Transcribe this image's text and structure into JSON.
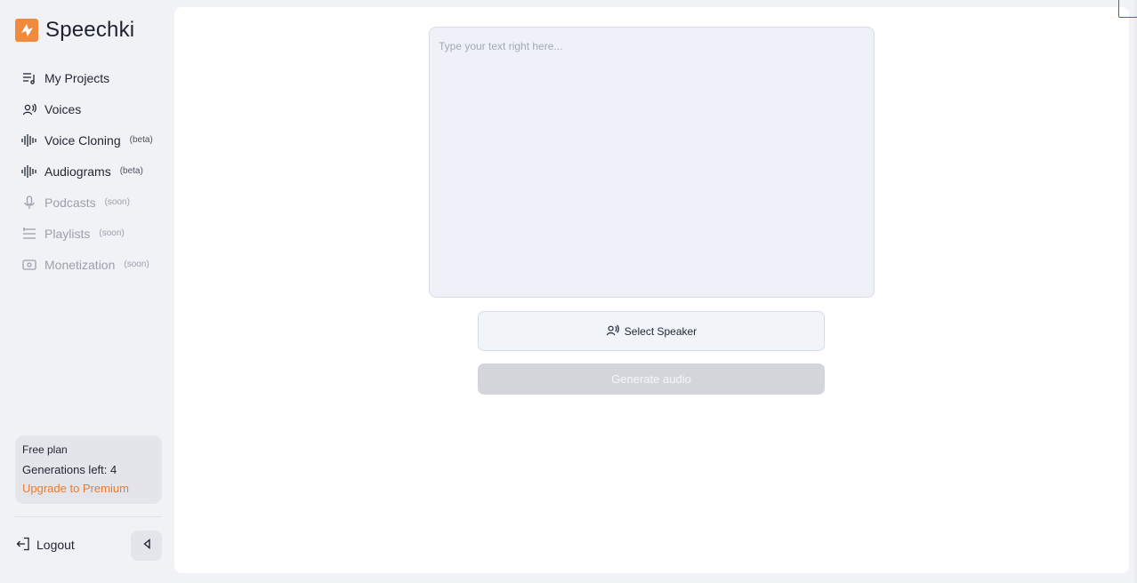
{
  "app": {
    "name": "Speechki"
  },
  "sidebar": {
    "items": [
      {
        "label": "My Projects",
        "tag": "",
        "icon": "projects-list-icon",
        "state": "active"
      },
      {
        "label": "Voices",
        "tag": "",
        "icon": "voices-icon",
        "state": "active"
      },
      {
        "label": "Voice Cloning",
        "tag": "(beta)",
        "icon": "waveform-icon",
        "state": "active"
      },
      {
        "label": "Audiograms",
        "tag": "(beta)",
        "icon": "waveform-icon",
        "state": "active"
      },
      {
        "label": "Podcasts",
        "tag": "(soon)",
        "icon": "microphone-icon",
        "state": "soon"
      },
      {
        "label": "Playlists",
        "tag": "(soon)",
        "icon": "playlist-icon",
        "state": "soon"
      },
      {
        "label": "Monetization",
        "tag": "(soon)",
        "icon": "money-icon",
        "state": "soon"
      }
    ],
    "plan": {
      "name": "Free plan",
      "generations": "Generations left: 4",
      "upgrade": "Upgrade to Premium"
    },
    "logout": "Logout"
  },
  "editor": {
    "placeholder": "Type your text right here...",
    "value": ""
  },
  "buttons": {
    "select_speaker": "Select Speaker",
    "generate": "Generate audio"
  },
  "colors": {
    "brand": "#f08a3c",
    "upgrade": "#ee7a2b",
    "disabled_button": "#d3d5da"
  }
}
